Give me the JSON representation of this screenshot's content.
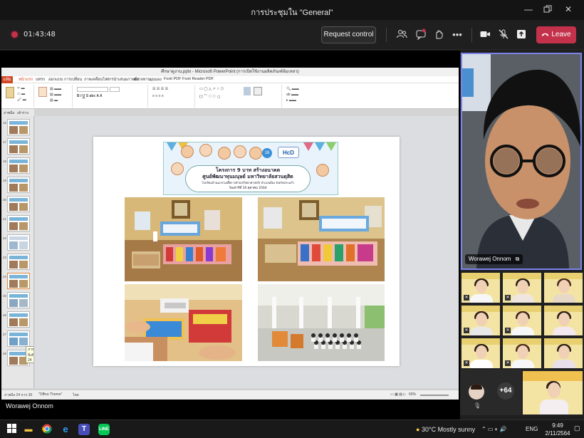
{
  "window": {
    "title": "การประชุมใน \"General\""
  },
  "callbar": {
    "timer": "01:43:48",
    "request_control": "Request control",
    "leave": "Leave"
  },
  "ppt": {
    "title": "ศึกษาดูงาน.pptx - Microsoft PowerPoint (การเปิดใช้งานผลิตภัณฑ์ล้มเหลว)",
    "tabs": [
      "แฟ้ม",
      "หน้าแรก",
      "แทรก",
      "ออกแบบ",
      "การเปลี่ยน",
      "ภาพเคลื่อนไหว",
      "การนำเสนอภาพนิ่ง",
      "ตรวจทาน",
      "มุมมอง",
      "Foxit PDF",
      "Foxit Reader PDF"
    ],
    "panel_tabs": [
      "ภาพนิ่ง",
      "เค้าร่าง"
    ],
    "thumb_numbers": [
      "16",
      "17",
      "18",
      "19",
      "20",
      "21",
      "22",
      "23",
      "24",
      "25",
      "26",
      "27",
      "28"
    ],
    "tooltip": "ภาพนิ่งที่ 24",
    "status_slide": "ภาพนิ่ง 24 จาก 30",
    "status_theme": "\"Office Theme\"",
    "status_lang": "ไทย",
    "status_zoom": "60%",
    "banner_line1": "โครงการ 9 บาท สร้างอนาคต",
    "banner_line2": "ศูนย์พัฒนาทุนมนุษย์ มหาวิทยาลัยสวนดุสิต",
    "banner_line3": "โรงเรียนบ้านมะขามเตี้ยการตำบล(วิทยาศาสตร์)  อำเภอเมือง จังหวัดสระแก้ว",
    "banner_line4": "วันเสาร์ที่ 16 ตุลาคม 2564",
    "logo_text": "HcD",
    "logo_number": "16"
  },
  "speaker": {
    "name": "Worawej Onnom"
  },
  "footer_name": "Worawej Onnom",
  "more_count": "+64",
  "taskbar": {
    "weather": "30°C  Mostly sunny",
    "lang": "ENG",
    "time": "9:49",
    "date": "2/11/2564"
  }
}
